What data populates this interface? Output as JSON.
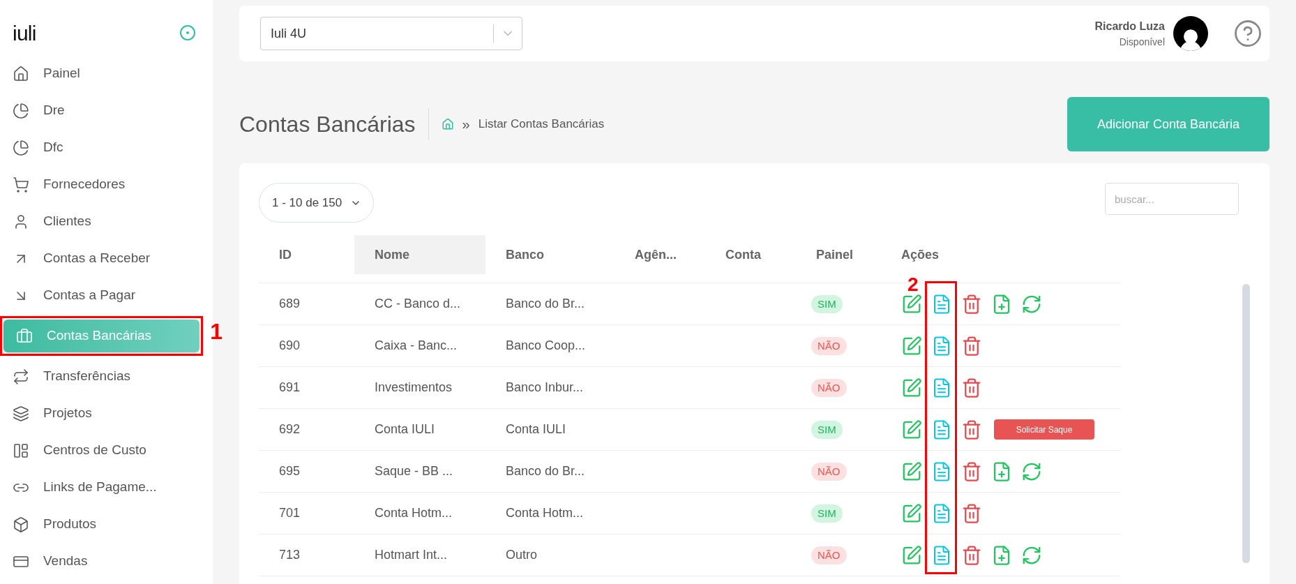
{
  "sidebar": {
    "logo": "iuli",
    "items": [
      {
        "label": "Painel",
        "selected": false
      },
      {
        "label": "Dre",
        "selected": false
      },
      {
        "label": "Dfc",
        "selected": false
      },
      {
        "label": "Fornecedores",
        "selected": false
      },
      {
        "label": "Clientes",
        "selected": false
      },
      {
        "label": "Contas a Receber",
        "selected": false
      },
      {
        "label": "Contas a Pagar",
        "selected": false
      },
      {
        "label": "Contas Bancárias",
        "selected": true
      },
      {
        "label": "Transferências",
        "selected": false
      },
      {
        "label": "Projetos",
        "selected": false
      },
      {
        "label": "Centros de Custo",
        "selected": false
      },
      {
        "label": "Links de Pagame...",
        "selected": false
      },
      {
        "label": "Produtos",
        "selected": false
      },
      {
        "label": "Vendas",
        "selected": false
      }
    ]
  },
  "header": {
    "company_select": "Iuli 4U",
    "user_name": "Ricardo Luza",
    "user_status": "Disponível"
  },
  "page": {
    "title": "Contas Bancárias",
    "breadcrumb_separator": "»",
    "breadcrumb": "Listar Contas Bancárias",
    "add_button": "Adicionar Conta Bancária"
  },
  "table": {
    "page_size": "1 - 10 de 150",
    "search": {
      "placeholder": "buscar..."
    },
    "columns": [
      {
        "label": "ID",
        "selected": false
      },
      {
        "label": "Nome",
        "selected": true
      },
      {
        "label": "Banco",
        "selected": false
      },
      {
        "label": "Agên...",
        "selected": false
      },
      {
        "label": "Conta",
        "selected": false
      },
      {
        "label": "Painel",
        "selected": false
      },
      {
        "label": "Ações",
        "selected": false
      }
    ],
    "rows": [
      {
        "id": "689",
        "name": "CC - Banco d...",
        "bank": "Banco do Br...",
        "panel": {
          "label": "SIM",
          "on": true
        },
        "actions": [
          {
            "kind": "edit"
          },
          {
            "kind": "view"
          },
          {
            "kind": "delete"
          },
          {
            "kind": "add-file"
          },
          {
            "kind": "sync"
          }
        ]
      },
      {
        "id": "690",
        "name": "Caixa - Banc...",
        "bank": "Banco Coop...",
        "panel": {
          "label": "NÃO",
          "on": false
        },
        "actions": [
          {
            "kind": "edit"
          },
          {
            "kind": "view"
          },
          {
            "kind": "delete"
          }
        ]
      },
      {
        "id": "691",
        "name": "Investimentos",
        "bank": "Banco Inbur...",
        "panel": {
          "label": "NÃO",
          "on": false
        },
        "actions": [
          {
            "kind": "edit"
          },
          {
            "kind": "view"
          },
          {
            "kind": "delete"
          }
        ]
      },
      {
        "id": "692",
        "name": "Conta IULI",
        "bank": "Conta IULI",
        "panel": {
          "label": "SIM",
          "on": true
        },
        "actions": [
          {
            "kind": "edit"
          },
          {
            "kind": "view"
          },
          {
            "kind": "delete"
          },
          {
            "kind": "withdraw",
            "label": "Solicitar Saque"
          }
        ]
      },
      {
        "id": "695",
        "name": "Saque - BB ...",
        "bank": "Banco do Br...",
        "panel": {
          "label": "NÃO",
          "on": false
        },
        "actions": [
          {
            "kind": "edit"
          },
          {
            "kind": "view"
          },
          {
            "kind": "delete"
          },
          {
            "kind": "add-file"
          },
          {
            "kind": "sync"
          }
        ]
      },
      {
        "id": "701",
        "name": "Conta Hotm...",
        "bank": "Conta Hotm...",
        "panel": {
          "label": "SIM",
          "on": true
        },
        "actions": [
          {
            "kind": "edit"
          },
          {
            "kind": "view"
          },
          {
            "kind": "delete"
          }
        ]
      },
      {
        "id": "713",
        "name": "Hotmart Int...",
        "bank": "Outro",
        "panel": {
          "label": "NÃO",
          "on": false
        },
        "actions": [
          {
            "kind": "edit"
          },
          {
            "kind": "view"
          },
          {
            "kind": "delete"
          },
          {
            "kind": "add-file"
          },
          {
            "kind": "sync"
          }
        ]
      }
    ]
  },
  "annotations": [
    {
      "label": "1"
    },
    {
      "label": "2"
    }
  ]
}
